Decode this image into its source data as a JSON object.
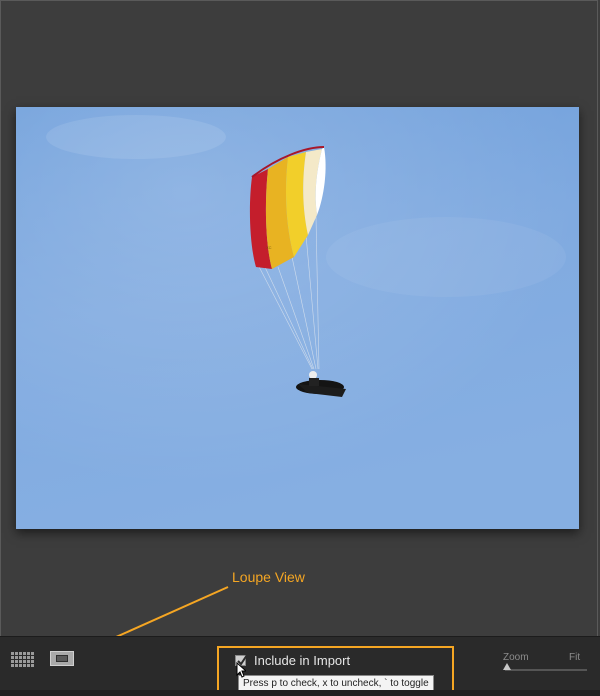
{
  "annotation": {
    "label": "Loupe View",
    "color": "#f5a623"
  },
  "toolbar": {
    "grid_view_icon": "grid-icon",
    "loupe_view_icon": "loupe-view-icon",
    "include_checkbox": {
      "label": "Include in Import",
      "checked": true
    },
    "tooltip": "Press p to check, x to uncheck, ` to toggle",
    "zoom": {
      "label": "Zoom",
      "fit_label": "Fit"
    }
  },
  "preview": {
    "subject": "paraglider",
    "sky_color": "#7ba6dd"
  }
}
